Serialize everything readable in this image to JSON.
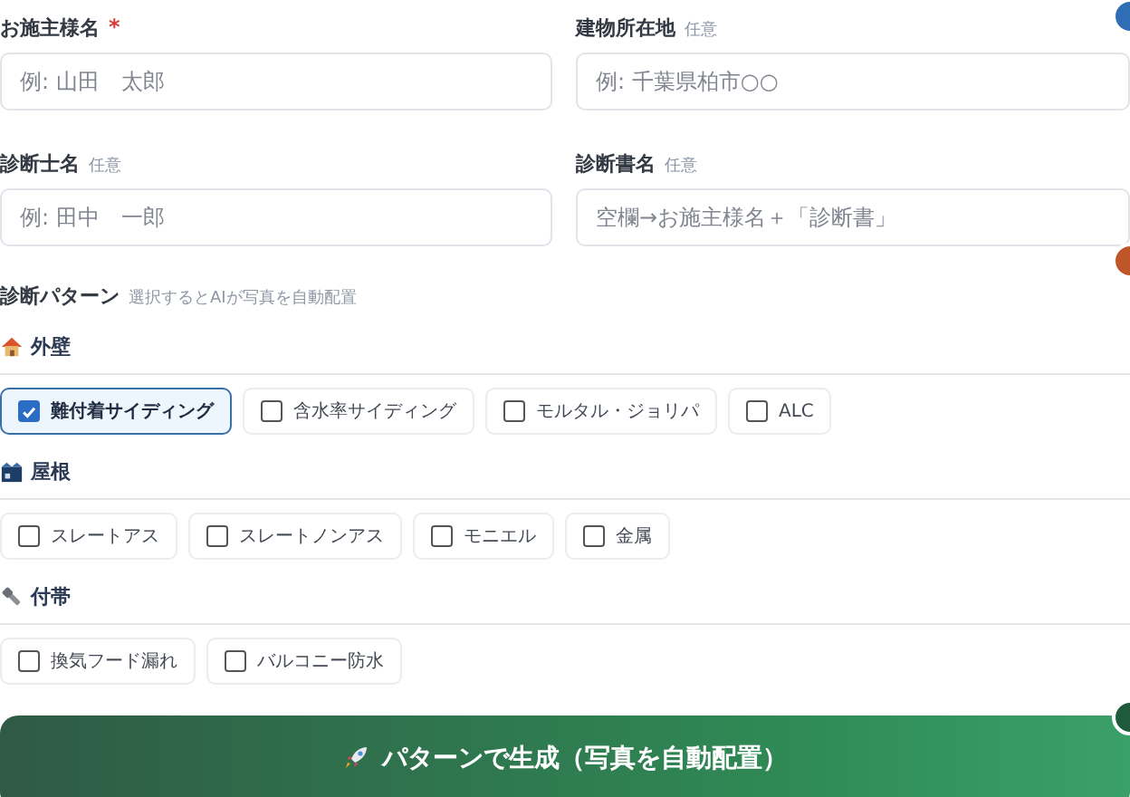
{
  "fields": [
    {
      "label": "お施主様名",
      "required": true,
      "placeholder": "例: 山田　太郎"
    },
    {
      "label": "建物所在地",
      "required": false,
      "optional_tag": "任意",
      "placeholder": "例: 千葉県柏市○○"
    },
    {
      "label": "診断士名",
      "required": false,
      "optional_tag": "任意",
      "placeholder": "例: 田中　一郎"
    },
    {
      "label": "診断書名",
      "required": false,
      "optional_tag": "任意",
      "placeholder": "空欄→お施主様名＋「診断書」"
    }
  ],
  "required_mark": "*",
  "pattern_section": {
    "title": "診断パターン",
    "hint": "選択するとAIが写真を自動配置"
  },
  "groups": [
    {
      "kind": "house",
      "title": "外壁",
      "options": [
        {
          "label": "難付着サイディング",
          "checked": true
        },
        {
          "label": "含水率サイディング",
          "checked": false
        },
        {
          "label": "モルタル・ジョリパ",
          "checked": false
        },
        {
          "label": "ALC",
          "checked": false
        }
      ]
    },
    {
      "kind": "roof",
      "title": "屋根",
      "options": [
        {
          "label": "スレートアス",
          "checked": false
        },
        {
          "label": "スレートノンアス",
          "checked": false
        },
        {
          "label": "モニエル",
          "checked": false
        },
        {
          "label": "金属",
          "checked": false
        }
      ]
    },
    {
      "kind": "bolt",
      "title": "付帯",
      "options": [
        {
          "label": "換気フード漏れ",
          "checked": false
        },
        {
          "label": "バルコニー防水",
          "checked": false
        }
      ]
    }
  ],
  "generate_button": {
    "label": "パターンで生成（写真を自動配置）"
  },
  "step_badges": [
    {
      "color": "#2f6db5"
    },
    {
      "color": "#c0552a"
    },
    {
      "color": "#1f5a3c"
    }
  ]
}
